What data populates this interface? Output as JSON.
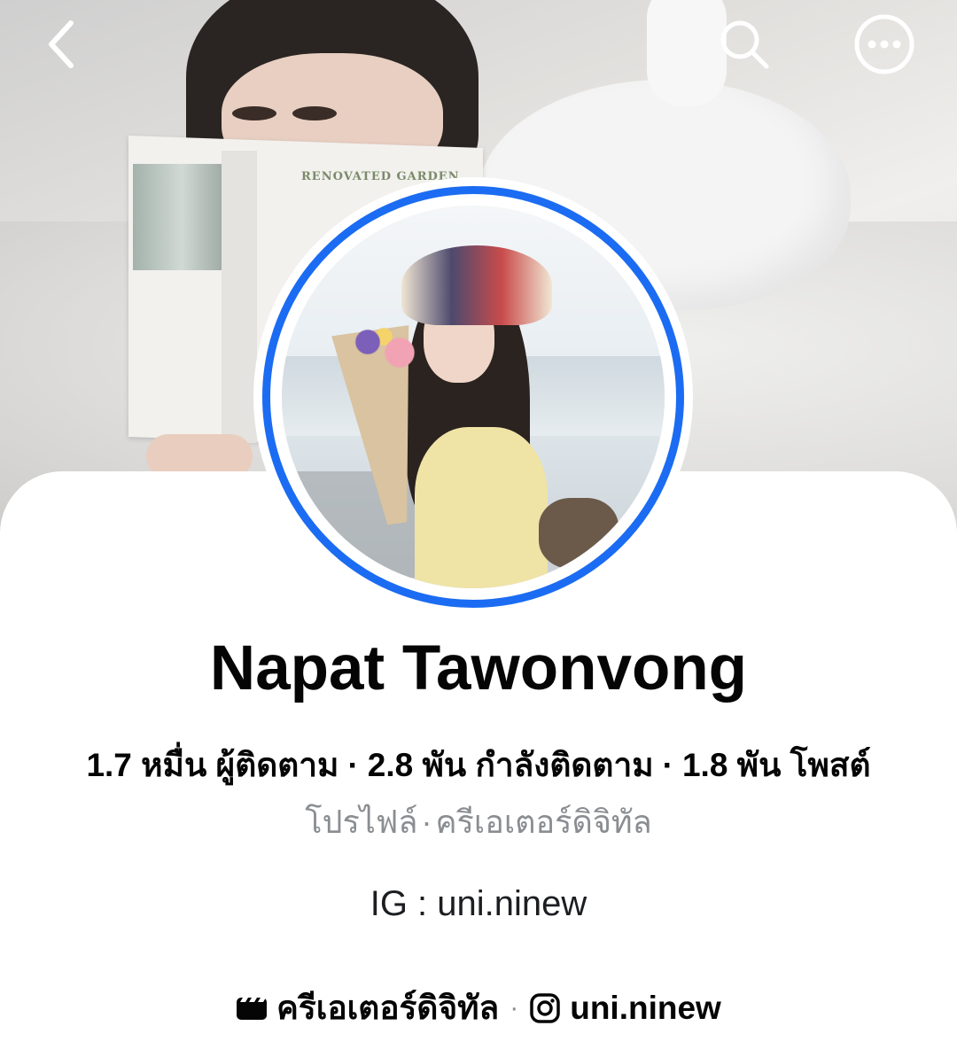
{
  "profile": {
    "name": "Napat Tawonvong",
    "stats": {
      "followers": "1.7 หมื่น ผู้ติดตาม",
      "following": "2.8 พัน กำลังติดตาม",
      "posts": "1.8 พัน โพสต์",
      "separator": "·"
    },
    "subtitle": {
      "type": "โปรไฟล์",
      "category": "ครีเอเตอร์ดิจิทัล",
      "separator": "·"
    },
    "bio": "IG : uni.ninew",
    "links": {
      "creator_label": "ครีเอเตอร์ดิจิทัล",
      "instagram_label": "uni.ninew",
      "separator": "·"
    }
  },
  "cover": {
    "book_title": "RENOVATED GARDEN"
  },
  "icons": {
    "back": "chevron-left-icon",
    "search": "search-icon",
    "more": "more-horizontal-icon",
    "creator": "video-icon",
    "instagram": "instagram-icon"
  },
  "colors": {
    "story_ring": "#1b6cf2",
    "text_primary": "#050505",
    "text_secondary": "#8a8d91"
  }
}
